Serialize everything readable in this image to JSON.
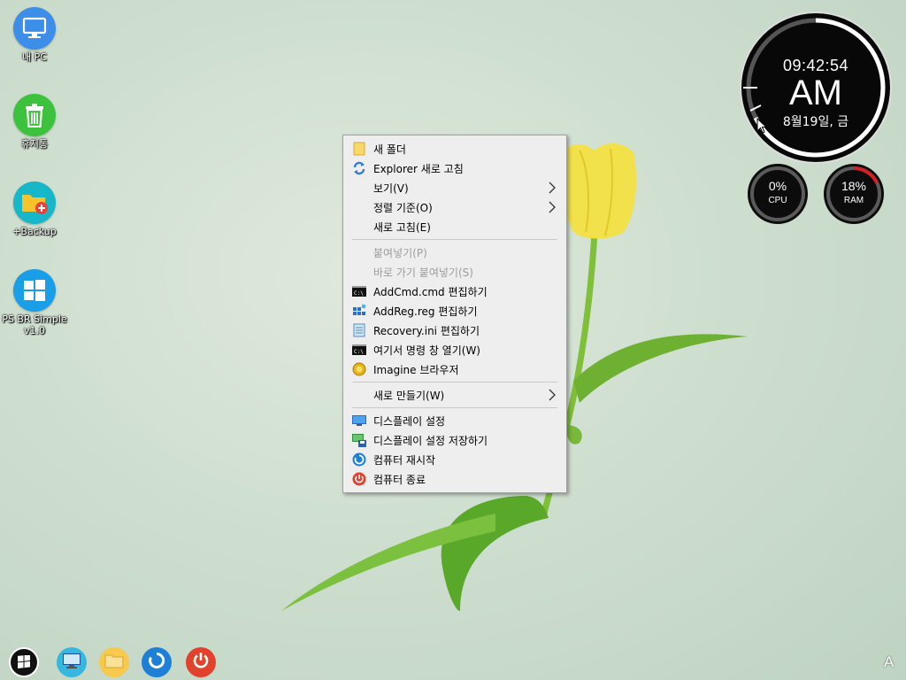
{
  "desktop": {
    "icons": [
      {
        "label": "내 PC",
        "icon": "monitor-icon",
        "color": "#3d8ee8"
      },
      {
        "label": "휴지통",
        "icon": "trash-icon",
        "color": "#3cc23c"
      },
      {
        "label": "+Backup",
        "icon": "folder-plus-icon",
        "color": "#17b6c8"
      },
      {
        "label": "PS BR Simple",
        "label2": "v1.0",
        "icon": "windows-icon",
        "color": "#1a9ee8"
      }
    ]
  },
  "clock": {
    "time": "09:42:54",
    "ampm": "AM",
    "date": "8월19일, 금"
  },
  "gauges": {
    "cpu": {
      "value": "0%",
      "label": "CPU",
      "fraction": 0.0
    },
    "ram": {
      "value": "18%",
      "label": "RAM",
      "fraction": 0.18,
      "color": "#d42020"
    }
  },
  "context_menu": {
    "groups": [
      [
        {
          "label": "새 폴더",
          "icon": "folder-icon"
        },
        {
          "label": "Explorer 새로 고침",
          "icon": "refresh-icon"
        },
        {
          "label": "보기(V)",
          "submenu": true
        },
        {
          "label": "정렬 기준(O)",
          "submenu": true
        },
        {
          "label": "새로 고침(E)"
        }
      ],
      [
        {
          "label": "붙여넣기(P)",
          "disabled": true
        },
        {
          "label": "바로 가기 붙여넣기(S)",
          "disabled": true
        },
        {
          "label": "AddCmd.cmd 편집하기",
          "icon": "cmd-icon"
        },
        {
          "label": "AddReg.reg 편집하기",
          "icon": "registry-icon"
        },
        {
          "label": "Recovery.ini 편집하기",
          "icon": "notepad-icon"
        },
        {
          "label": "여기서 명령 창 열기(W)",
          "icon": "cmd-icon"
        },
        {
          "label": "Imagine 브라우저",
          "icon": "imagine-icon"
        }
      ],
      [
        {
          "label": "새로 만들기(W)",
          "submenu": true
        }
      ],
      [
        {
          "label": "디스플레이 설정",
          "icon": "display-icon"
        },
        {
          "label": "디스플레이 설정 저장하기",
          "icon": "save-display-icon"
        },
        {
          "label": "컴퓨터 재시작",
          "icon": "restart-icon"
        },
        {
          "label": "컴퓨터 종료",
          "icon": "power-icon"
        }
      ]
    ]
  },
  "taskbar": {
    "items": [
      "start-icon",
      "monitor-icon",
      "folder-icon",
      "restart-icon",
      "power-icon"
    ],
    "language_indicator": "A"
  }
}
